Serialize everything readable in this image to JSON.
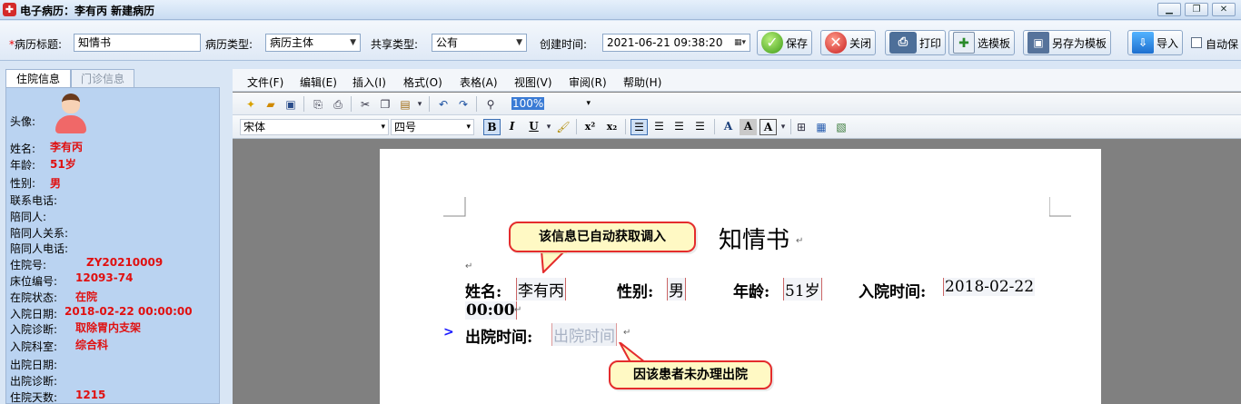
{
  "window": {
    "title": "电子病历：李有丙 新建病历"
  },
  "toolbar": {
    "title_label": "病历标题:",
    "required_mark": "*",
    "title_value": "知情书",
    "type_label": "病历类型:",
    "type_value": "病历主体",
    "share_label": "共享类型:",
    "share_value": "公有",
    "time_label": "创建时间:",
    "time_value": "2021-06-21 09:38:20",
    "save": "保存",
    "close": "关闭",
    "print": "打印",
    "template": "选模板",
    "save_as_template": "另存为模板",
    "import": "导入",
    "auto_save": "自动保"
  },
  "left_tabs": [
    "住院信息",
    "门诊信息"
  ],
  "patient": {
    "avatar_label": "头像:",
    "fields": [
      {
        "label": "姓名:",
        "value": "李有丙"
      },
      {
        "label": "年龄:",
        "value": "51岁"
      },
      {
        "label": "性别:",
        "value": "男"
      },
      {
        "label": "联系电话:",
        "value": ""
      },
      {
        "label": "陪同人:",
        "value": ""
      },
      {
        "label": "陪同人关系:",
        "value": ""
      },
      {
        "label": "陪同人电话:",
        "value": ""
      },
      {
        "label": "住院号:",
        "value": "ZY20210009"
      },
      {
        "label": "床位编号:",
        "value": "12093-74"
      },
      {
        "label": "在院状态:",
        "value": "在院"
      },
      {
        "label": "入院日期:",
        "value": "2018-02-22 00:00:00"
      },
      {
        "label": "入院诊断:",
        "value": "取除胃内支架"
      },
      {
        "label": "入院科室:",
        "value": "综合科"
      },
      {
        "label": "出院日期:",
        "value": ""
      },
      {
        "label": "出院诊断:",
        "value": ""
      },
      {
        "label": "住院天数:",
        "value": "1215"
      }
    ]
  },
  "editor": {
    "menus": [
      "文件(F)",
      "编辑(E)",
      "插入(I)",
      "格式(O)",
      "表格(A)",
      "视图(V)",
      "审阅(R)",
      "帮助(H)"
    ],
    "zoom": "100%",
    "font_name": "宋体",
    "font_size": "四号",
    "format_buttons": {
      "bold": "B",
      "italic": "I",
      "underline": "U",
      "superscript": "x²",
      "subscript": "x₂"
    }
  },
  "document": {
    "title": "知情书",
    "name_label": "姓名:",
    "name_value": "李有丙",
    "gender_label": "性别:",
    "gender_value": "男",
    "age_label": "年龄:",
    "age_value": "51岁",
    "admit_label": "入院时间:",
    "admit_value_1": "2018-02-22",
    "admit_value_2": "00:00",
    "discharge_label": "出院时间:",
    "discharge_placeholder": "出院时间",
    "row_marker": ">",
    "para_mark": "↵"
  },
  "callouts": {
    "auto_fetch": "该信息已自动获取调入",
    "not_discharged": "因该患者未办理出院"
  },
  "colors": {
    "required": "#ee0000",
    "patient_value": "#e01010",
    "callout_border": "#e42c2c",
    "callout_fill": "#fff9c4"
  }
}
